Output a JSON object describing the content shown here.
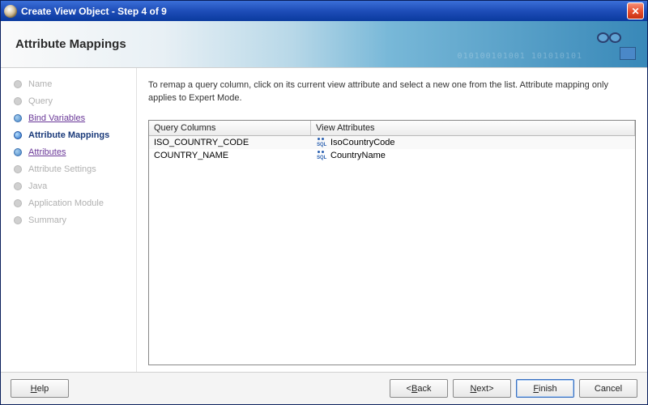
{
  "window": {
    "title": "Create View Object - Step 4 of 9"
  },
  "banner": {
    "title": "Attribute Mappings",
    "digits": "010100101001 101010101"
  },
  "sidebar": {
    "steps": [
      {
        "label": "Name",
        "state": "disabled"
      },
      {
        "label": "Query",
        "state": "disabled"
      },
      {
        "label": "Bind Variables",
        "state": "enabled"
      },
      {
        "label": "Attribute Mappings",
        "state": "current"
      },
      {
        "label": "Attributes",
        "state": "enabled"
      },
      {
        "label": "Attribute Settings",
        "state": "disabled"
      },
      {
        "label": "Java",
        "state": "disabled"
      },
      {
        "label": "Application Module",
        "state": "disabled"
      },
      {
        "label": "Summary",
        "state": "disabled"
      }
    ]
  },
  "content": {
    "instruction": "To remap a query column, click on its current view attribute and select a new one from the list.  Attribute mapping only applies to Expert Mode.",
    "table": {
      "headers": {
        "col1": "Query Columns",
        "col2": "View Attributes"
      },
      "rows": [
        {
          "query": "ISO_COUNTRY_CODE",
          "attr": "IsoCountryCode"
        },
        {
          "query": "COUNTRY_NAME",
          "attr": "CountryName"
        }
      ]
    }
  },
  "footer": {
    "help": "Help",
    "back": "Back",
    "next": "Next",
    "finish": "Finish",
    "cancel": "Cancel"
  }
}
